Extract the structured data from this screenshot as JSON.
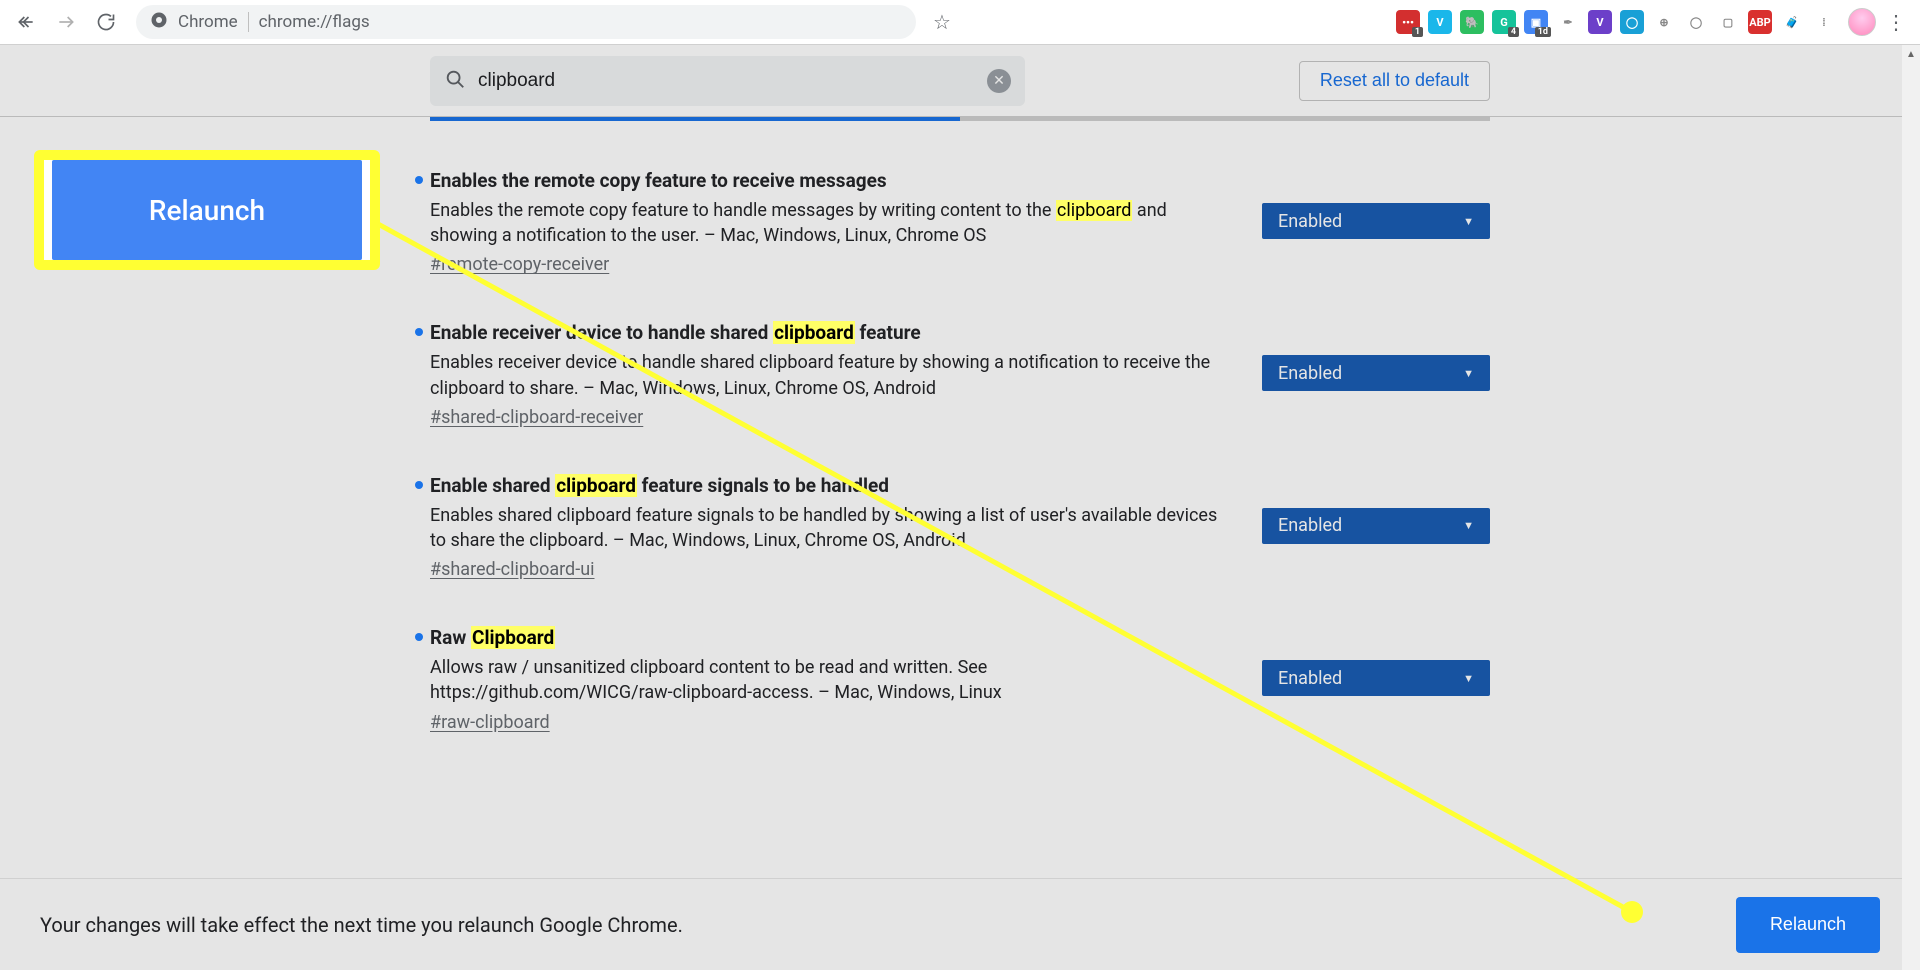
{
  "chrome": {
    "title_prefix": "Chrome",
    "url": "chrome://flags",
    "back_icon": "arrow-left",
    "forward_icon": "arrow-right",
    "reload_icon": "reload"
  },
  "extensions": [
    {
      "name": "lastpass",
      "bg": "#d32f2f",
      "glyph": "•••",
      "badge": "1"
    },
    {
      "name": "vimeo",
      "bg": "#1ab7ea",
      "glyph": "V"
    },
    {
      "name": "evernote",
      "bg": "#2dbe60",
      "glyph": "🐘"
    },
    {
      "name": "grammarly",
      "bg": "#15c39a",
      "glyph": "G",
      "badge": "4"
    },
    {
      "name": "onetab",
      "bg": "#4285f4",
      "glyph": "▣",
      "badge": "1d"
    },
    {
      "name": "pen",
      "bg": "transparent",
      "glyph": "✒",
      "fg": "#888"
    },
    {
      "name": "vidyard",
      "bg": "#6c3fc9",
      "glyph": "V"
    },
    {
      "name": "loom",
      "bg": "#19a0d6",
      "glyph": "◯"
    },
    {
      "name": "plus",
      "bg": "transparent",
      "glyph": "⊕",
      "fg": "#888"
    },
    {
      "name": "circle",
      "bg": "transparent",
      "glyph": "◯",
      "fg": "#888"
    },
    {
      "name": "box",
      "bg": "transparent",
      "glyph": "▢",
      "fg": "#888"
    },
    {
      "name": "adblock",
      "bg": "#d9302f",
      "glyph": "ABP"
    },
    {
      "name": "briefcase",
      "bg": "transparent",
      "glyph": "🧳",
      "fg": "#888"
    },
    {
      "name": "dots",
      "bg": "transparent",
      "glyph": "⁞",
      "fg": "#888"
    }
  ],
  "toolbar": {
    "search_value": "clipboard",
    "reset_label": "Reset all to default"
  },
  "flags": [
    {
      "title_pre": "Enables the remote copy feature to receive messages",
      "title_hl": "",
      "title_post": "",
      "desc_pre": "Enables the remote copy feature to handle messages by writing content to the ",
      "desc_hl": "clipboard",
      "desc_post": " and showing a notification to the user. – Mac, Windows, Linux, Chrome OS",
      "hash": "#remote-copy-receiver",
      "value": "Enabled"
    },
    {
      "title_pre": "Enable receiver device to handle shared ",
      "title_hl": "clipboard",
      "title_post": " feature",
      "desc_pre": "Enables receiver device to handle shared clipboard feature by showing a notification to receive the clipboard to share. – Mac, Windows, Linux, Chrome OS, Android",
      "desc_hl": "",
      "desc_post": "",
      "hash": "#shared-clipboard-receiver",
      "value": "Enabled"
    },
    {
      "title_pre": "Enable shared ",
      "title_hl": "clipboard",
      "title_post": " feature signals to be handled",
      "desc_pre": "Enables shared clipboard feature signals to be handled by showing a list of user's available devices to share the clipboard. – Mac, Windows, Linux, Chrome OS, Android",
      "desc_hl": "",
      "desc_post": "",
      "hash": "#shared-clipboard-ui",
      "value": "Enabled"
    },
    {
      "title_pre": "Raw ",
      "title_hl": "Clipboard",
      "title_post": "",
      "desc_pre": "Allows raw / unsanitized clipboard content to be read and written. See https://github.com/WICG/raw-clipboard-access. – Mac, Windows, Linux",
      "desc_hl": "",
      "desc_post": "",
      "hash": "#raw-clipboard",
      "value": "Enabled"
    }
  ],
  "footer": {
    "message": "Your changes will take effect the next time you relaunch Google Chrome.",
    "relaunch_label": "Relaunch"
  },
  "callout": {
    "label": "Relaunch"
  }
}
